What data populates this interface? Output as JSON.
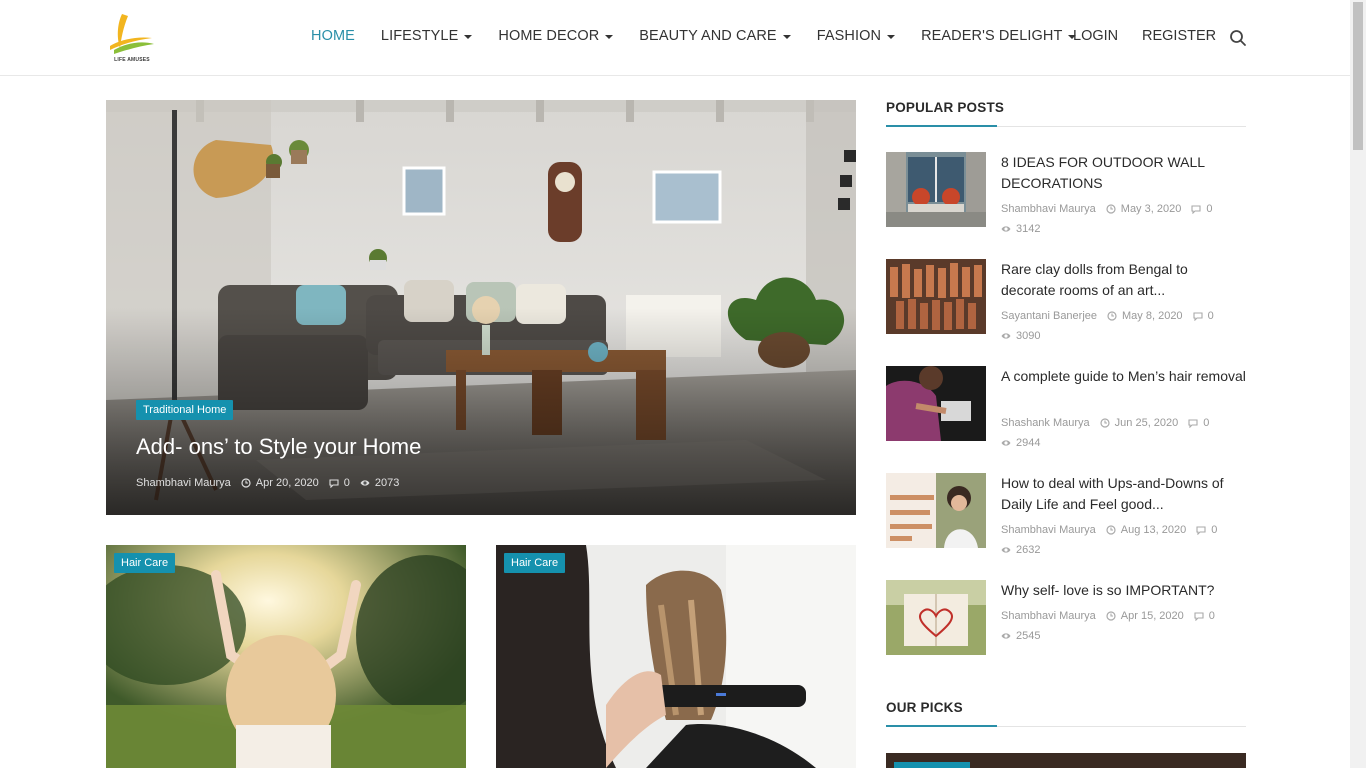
{
  "logo": {
    "text": "LIFE AMUSES"
  },
  "nav": {
    "items": [
      {
        "label": "HOME",
        "dropdown": false,
        "active": true
      },
      {
        "label": "LIFESTYLE",
        "dropdown": true,
        "active": false
      },
      {
        "label": "HOME DECOR",
        "dropdown": true,
        "active": false
      },
      {
        "label": "BEAUTY AND CARE",
        "dropdown": true,
        "active": false
      },
      {
        "label": "FASHION",
        "dropdown": true,
        "active": false
      },
      {
        "label": "READER'S DELIGHT",
        "dropdown": true,
        "active": false
      }
    ],
    "login": "LOGIN",
    "register": "REGISTER"
  },
  "featured": {
    "category": "Traditional Home",
    "title": "Add- ons’ to Style your Home",
    "author": "Shambhavi Maurya",
    "date": "Apr 20, 2020",
    "comments": "0",
    "views": "2073"
  },
  "cards": [
    {
      "category": "Hair Care"
    },
    {
      "category": "Hair Care"
    }
  ],
  "popular": {
    "heading": "POPULAR POSTS",
    "posts": [
      {
        "title": "8 IDEAS FOR OUTDOOR WALL DECORATIONS",
        "author": "Shambhavi Maurya",
        "date": "May 3, 2020",
        "comments": "0",
        "views": "3142"
      },
      {
        "title": "Rare clay dolls from Bengal to decorate rooms of an art...",
        "author": "Sayantani Banerjee",
        "date": "May 8, 2020",
        "comments": "0",
        "views": "3090"
      },
      {
        "title": "A complete guide to Men’s hair removal",
        "author": "Shashank Maurya",
        "date": "Jun 25, 2020",
        "comments": "0",
        "views": "2944"
      },
      {
        "title": "How to deal with Ups-and-Downs of Daily Life and Feel good...",
        "author": "Shambhavi Maurya",
        "date": "Aug 13, 2020",
        "comments": "0",
        "views": "2632"
      },
      {
        "title": "Why self- love is so IMPORTANT?",
        "author": "Shambhavi Maurya",
        "date": "Apr 15, 2020",
        "comments": "0",
        "views": "2545"
      }
    ]
  },
  "picks": {
    "heading": "OUR PICKS"
  },
  "colors": {
    "accent": "#2a8fa8",
    "badge": "#1591ae"
  },
  "icons": [
    "search-icon",
    "clock-icon",
    "comment-icon",
    "eye-icon",
    "caret-down-icon"
  ]
}
